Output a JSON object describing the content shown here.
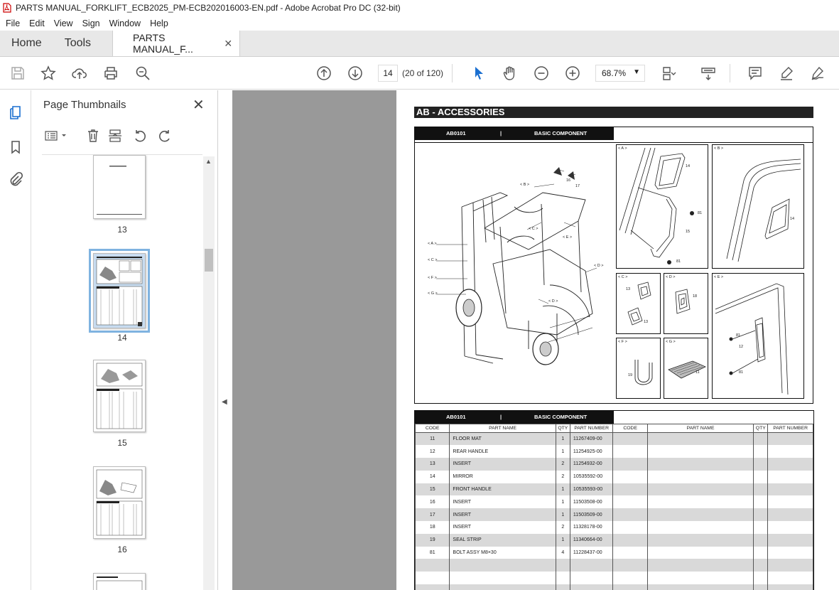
{
  "window": {
    "title": "PARTS MANUAL_FORKLIFT_ECB2025_PM-ECB202016003-EN.pdf - Adobe Acrobat Pro DC (32-bit)"
  },
  "menu": [
    "File",
    "Edit",
    "View",
    "Sign",
    "Window",
    "Help"
  ],
  "tabs": {
    "home": "Home",
    "tools": "Tools",
    "doc": "PARTS MANUAL_F...",
    "close": "✕"
  },
  "toolbar": {
    "page_current": "14",
    "page_count": "(20 of 120)",
    "zoom": "68.7%"
  },
  "panel": {
    "title": "Page Thumbnails",
    "close": "✕",
    "thumbs": [
      {
        "label": "13"
      },
      {
        "label": "14"
      },
      {
        "label": "15"
      },
      {
        "label": "16"
      }
    ]
  },
  "document": {
    "section_title": "AB - ACCESSORIES",
    "group_code": "AB0101",
    "group_sep": "|",
    "group_name": "BASIC COMPONENT",
    "callouts": {
      "A": "< A >",
      "B": "< B >",
      "C": "< C >",
      "D": "< D >",
      "E": "< E >",
      "F": "< F >",
      "G": "< G >",
      "n11": "11",
      "n12": "12",
      "n13": "13",
      "n14": "14",
      "n15": "15",
      "n16": "16",
      "n17": "17",
      "n18": "18",
      "n19": "19",
      "n81": "81"
    },
    "table": {
      "headers": [
        "CODE",
        "PART NAME",
        "QTY",
        "PART NUMBER",
        "CODE",
        "PART NAME",
        "QTY",
        "PART NUMBER"
      ],
      "rows": [
        {
          "code": "11",
          "name": "FLOOR MAT",
          "qty": "1",
          "number": "11267409-00"
        },
        {
          "code": "12",
          "name": "REAR HANDLE",
          "qty": "1",
          "number": "11254925-00"
        },
        {
          "code": "13",
          "name": "INSERT",
          "qty": "2",
          "number": "11254932-00"
        },
        {
          "code": "14",
          "name": "MIRROR",
          "qty": "2",
          "number": "10535592-00"
        },
        {
          "code": "15",
          "name": "FRONT HANDLE",
          "qty": "1",
          "number": "10535593-00"
        },
        {
          "code": "16",
          "name": "INSERT",
          "qty": "1",
          "number": "11503508-00"
        },
        {
          "code": "17",
          "name": "INSERT",
          "qty": "1",
          "number": "11503509-00"
        },
        {
          "code": "18",
          "name": "INSERT",
          "qty": "2",
          "number": "11328178-00"
        },
        {
          "code": "19",
          "name": "SEAL STRIP",
          "qty": "1",
          "number": "11340664-00"
        },
        {
          "code": "81",
          "name": "BOLT ASSY M8×30",
          "qty": "4",
          "number": "11228437-00"
        }
      ]
    }
  }
}
